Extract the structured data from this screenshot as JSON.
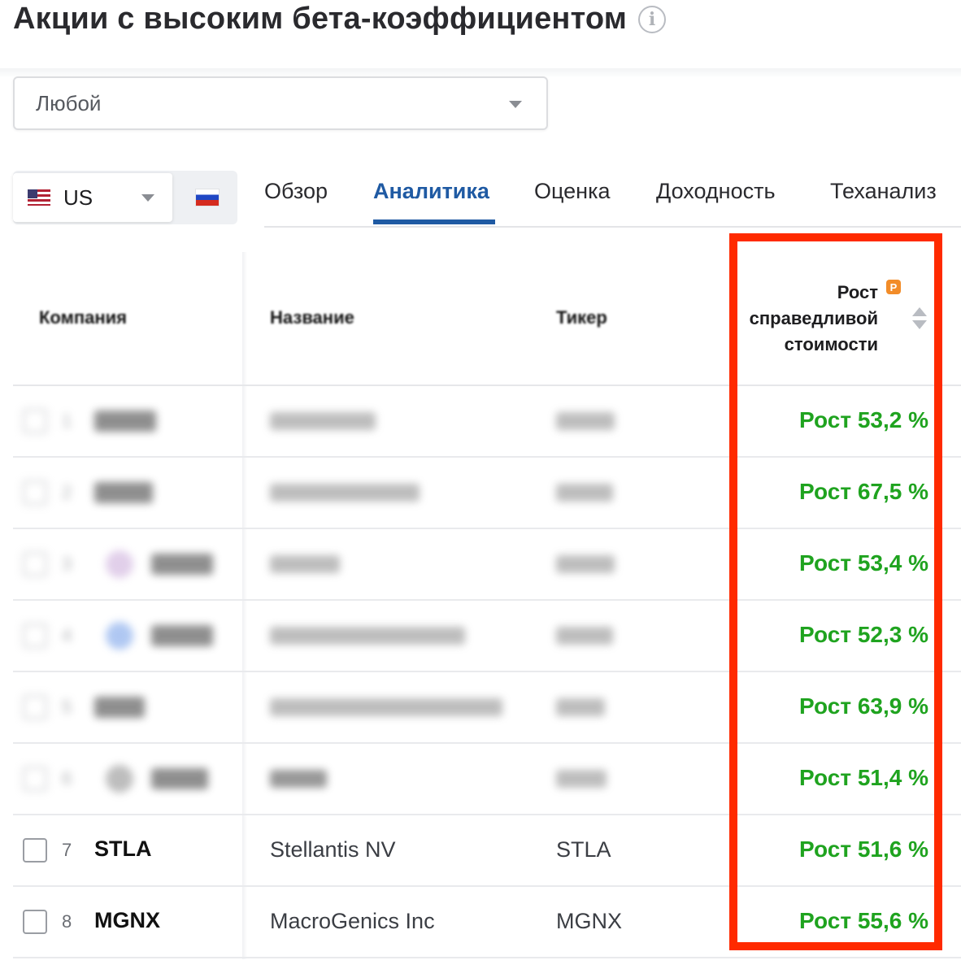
{
  "page": {
    "title": "Акции с высоким бета-коэффициентом",
    "info_icon": "info-icon"
  },
  "filter": {
    "selected": "Любой"
  },
  "market": {
    "selected": "US",
    "flags": [
      "us-flag-icon",
      "ru-flag-icon"
    ]
  },
  "tabs": [
    {
      "label": "Обзор",
      "active": false
    },
    {
      "label": "Аналитика",
      "active": true
    },
    {
      "label": "Оценка",
      "active": false
    },
    {
      "label": "Доходность",
      "active": false
    },
    {
      "label": "Теханализ",
      "active": false
    }
  ],
  "table": {
    "headers": {
      "company": "Компания",
      "name": "Название",
      "ticker": "Тикер",
      "fair_value_growth": "Рост справедливой стоимости"
    },
    "rows": [
      {
        "num": "1",
        "ticker": "",
        "name": "",
        "ticker2": "",
        "fair_value": "Рост 53,2 %",
        "blurred": true
      },
      {
        "num": "2",
        "ticker": "",
        "name": "",
        "ticker2": "",
        "fair_value": "Рост 67,5 %",
        "blurred": true
      },
      {
        "num": "3",
        "ticker": "",
        "name": "",
        "ticker2": "",
        "fair_value": "Рост 53,4 %",
        "blurred": true
      },
      {
        "num": "4",
        "ticker": "",
        "name": "",
        "ticker2": "",
        "fair_value": "Рост 52,3 %",
        "blurred": true
      },
      {
        "num": "5",
        "ticker": "",
        "name": "",
        "ticker2": "",
        "fair_value": "Рост 63,9 %",
        "blurred": true
      },
      {
        "num": "6",
        "ticker": "",
        "name": "",
        "ticker2": "",
        "fair_value": "Рост 51,4 %",
        "blurred": true
      },
      {
        "num": "7",
        "ticker": "STLA",
        "name": "Stellantis NV",
        "ticker2": "STLA",
        "fair_value": "Рост 51,6 %",
        "blurred": false
      },
      {
        "num": "8",
        "ticker": "MGNX",
        "name": "MacroGenics Inc",
        "ticker2": "MGNX",
        "fair_value": "Рост 55,6 %",
        "blurred": false
      }
    ]
  },
  "colors": {
    "accent": "#1f5aa3",
    "growth": "#1fa31f",
    "highlight": "#ff2a00",
    "premium": "#f28c28"
  }
}
